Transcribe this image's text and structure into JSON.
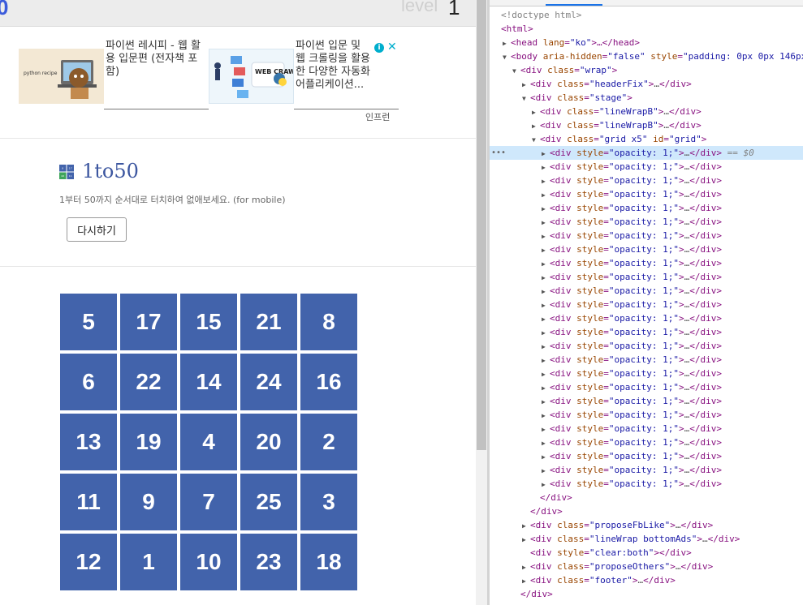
{
  "header": {
    "timer": "0",
    "level_label": "level",
    "level_value": "1"
  },
  "ads": {
    "ad1": {
      "thumb_text": "python recipe",
      "title": "파이썬 레시피 - 웹 활용 입문편 (전자책 포함)"
    },
    "ad2": {
      "thumb_text": "WEB CRAWLING",
      "title": "파이썬 입문 및 웹 크롤링을 활용한 다양한 자동화 어플리케이션..."
    },
    "info_icon": "i",
    "close_icon": "✕",
    "provider": "인프런"
  },
  "intro": {
    "logo": [
      "8",
      "17",
      "42",
      "11"
    ],
    "title": "1to50",
    "description": "1부터 50까지 순서대로 터치하여 없애보세요. (for mobile)",
    "restart_label": "다시하기"
  },
  "grid": {
    "cells": [
      5,
      17,
      15,
      21,
      8,
      6,
      22,
      14,
      24,
      16,
      13,
      19,
      4,
      20,
      2,
      11,
      9,
      7,
      25,
      3,
      12,
      1,
      10,
      23,
      18
    ]
  },
  "devtools": {
    "row_items": {
      "doctype": "<!doctype html>",
      "html_open": "<html>",
      "head_tag": "head",
      "head_attr": "lang",
      "head_val": "\"ko\"",
      "head_tail": ">…</",
      "head_close": "head>",
      "body_tag": "body",
      "body_attr1": "aria-hidden",
      "body_val1": "\"false\"",
      "body_attr2": "style",
      "body_val2": "\"padding: 0px 0px 146px",
      "wrap_tag": "div",
      "wrap_attr": "class",
      "wrap_val": "\"wrap\"",
      "headerfix_val": "\"headerFix\"",
      "stage_val": "\"stage\"",
      "linewrapb_val": "\"lineWrapB\"",
      "grid_val": "\"grid x5\"",
      "grid_id_attr": "id",
      "grid_id_val": "\"grid\"",
      "child_style_attr": "style",
      "child_style_val": "\"opacity: 1;\"",
      "selected_marker": "== $0",
      "div_close": "</div>",
      "proposefb_val": "\"proposeFbLike\"",
      "linewrap_bottom_val": "\"lineWrap bottomAds\"",
      "clear_style_val": "\"clear:both\"",
      "proposeothers_val": "\"proposeOthers\"",
      "footer_val": "\"footer\"",
      "ellipsis": "…",
      "dots": "•••"
    }
  }
}
